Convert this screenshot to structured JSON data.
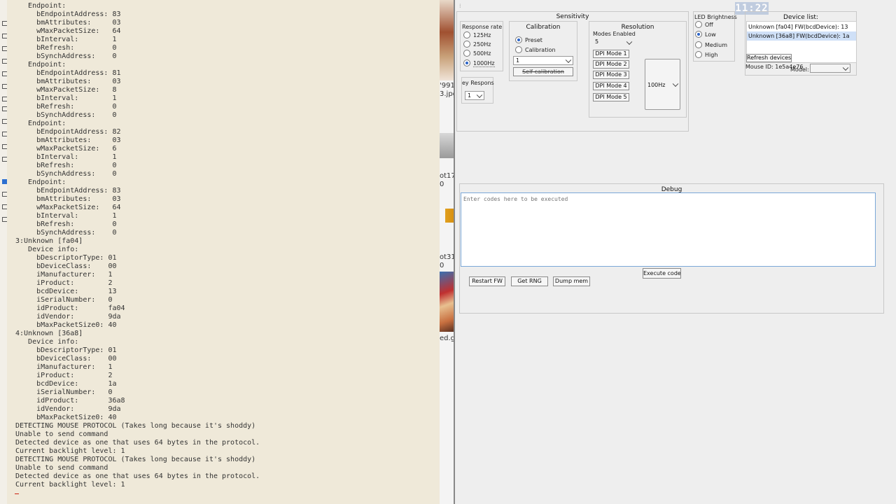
{
  "terminal": {
    "lines": [
      "   Endpoint:",
      "     bEndpointAddress: 83",
      "     bmAttributes:     03",
      "     wMaxPacketSize:   64",
      "     bInterval:        1",
      "     bRefresh:         0",
      "     bSynchAddress:    0",
      "   Endpoint:",
      "     bEndpointAddress: 81",
      "     bmAttributes:     03",
      "     wMaxPacketSize:   8",
      "     bInterval:        1",
      "     bRefresh:         0",
      "     bSynchAddress:    0",
      "   Endpoint:",
      "     bEndpointAddress: 82",
      "     bmAttributes:     03",
      "     wMaxPacketSize:   6",
      "     bInterval:        1",
      "     bRefresh:         0",
      "     bSynchAddress:    0",
      "   Endpoint:",
      "     bEndpointAddress: 83",
      "     bmAttributes:     03",
      "     wMaxPacketSize:   64",
      "     bInterval:        1",
      "     bRefresh:         0",
      "     bSynchAddress:    0",
      "3:Unknown [fa04]",
      "   Device info:",
      "     bDescriptorType: 01",
      "     bDeviceClass:    00",
      "     iManufacturer:   1",
      "     iProduct:        2",
      "     bcdDevice:       13",
      "     iSerialNumber:   0",
      "     idProduct:       fa04",
      "     idVendor:        9da",
      "     bMaxPacketSize0: 40",
      "4:Unknown [36a8]",
      "   Device info:",
      "     bDescriptorType: 01",
      "     bDeviceClass:    00",
      "     iManufacturer:   1",
      "     iProduct:        2",
      "     bcdDevice:       1a",
      "     iSerialNumber:   0",
      "     idProduct:       36a8",
      "     idVendor:        9da",
      "     bMaxPacketSize0: 40",
      "DETECTING MOUSE PROTOCOL (Takes long because it's shoddy)",
      "Unable to send command",
      "Detected device as one that uses 64 bytes in the protocol.",
      "Current backlight level: 1",
      "DETECTING MOUSE PROTOCOL (Takes long because it's shoddy)",
      "Unable to send command",
      "Detected device as one that uses 64 bytes in the protocol.",
      "Current backlight level: 1"
    ]
  },
  "background_window": {
    "labels": [
      "'991",
      "3.jpg",
      "ot17",
      "0",
      "ot31",
      "0",
      "ed.g"
    ]
  },
  "clock": {
    "time": "11:22"
  },
  "sensitivity": {
    "title": "Sensitivity",
    "response_rate": {
      "title": "Response rate",
      "options": [
        "125Hz",
        "250Hz",
        "500Hz",
        "1000Hz"
      ],
      "selected": "1000Hz"
    },
    "calibration": {
      "title": "Calibration",
      "options": [
        "Preset",
        "Calibration"
      ],
      "selected": "Preset",
      "select_value": "1",
      "self_calibration_label": "Self-calibration"
    },
    "key_response": {
      "title": "ey Respons",
      "value": "1"
    },
    "resolution": {
      "title": "Resolution",
      "modes_enabled_label": "Modes Enabled",
      "modes_enabled_value": "5",
      "dpi_modes": [
        "DPI Mode 1",
        "DPI Mode 2",
        "DPI Mode 3",
        "DPI Mode 4",
        "DPI Mode 5"
      ],
      "rate_value": "100Hz"
    }
  },
  "led": {
    "title": "LED Brightness",
    "options": [
      "Off",
      "Low",
      "Medium",
      "High"
    ],
    "selected": "Low"
  },
  "device_list": {
    "title": "Device list:",
    "items": [
      "Unknown [fa04] FW(bcdDevice): 13",
      "Unknown [36a8] FW(bcdDevice): 1a"
    ],
    "selected_index": 1,
    "refresh_label": "Refresh devices",
    "mouse_id_label": "Mouse ID: 1e5a4e76",
    "model_label": "Model:",
    "model_value": ""
  },
  "debug": {
    "title": "Debug",
    "placeholder": "Enter codes here to be executed",
    "execute_label": "Execute codes",
    "restart_label": "Restart FW",
    "rng_label": "Get RNG",
    "dump_label": "Dump mem"
  },
  "colors": {
    "terminal_bg": "#efe9d9",
    "app_bg": "#eeeeee",
    "accent": "#2a63c8",
    "selected_row": "#cfe0f7"
  }
}
